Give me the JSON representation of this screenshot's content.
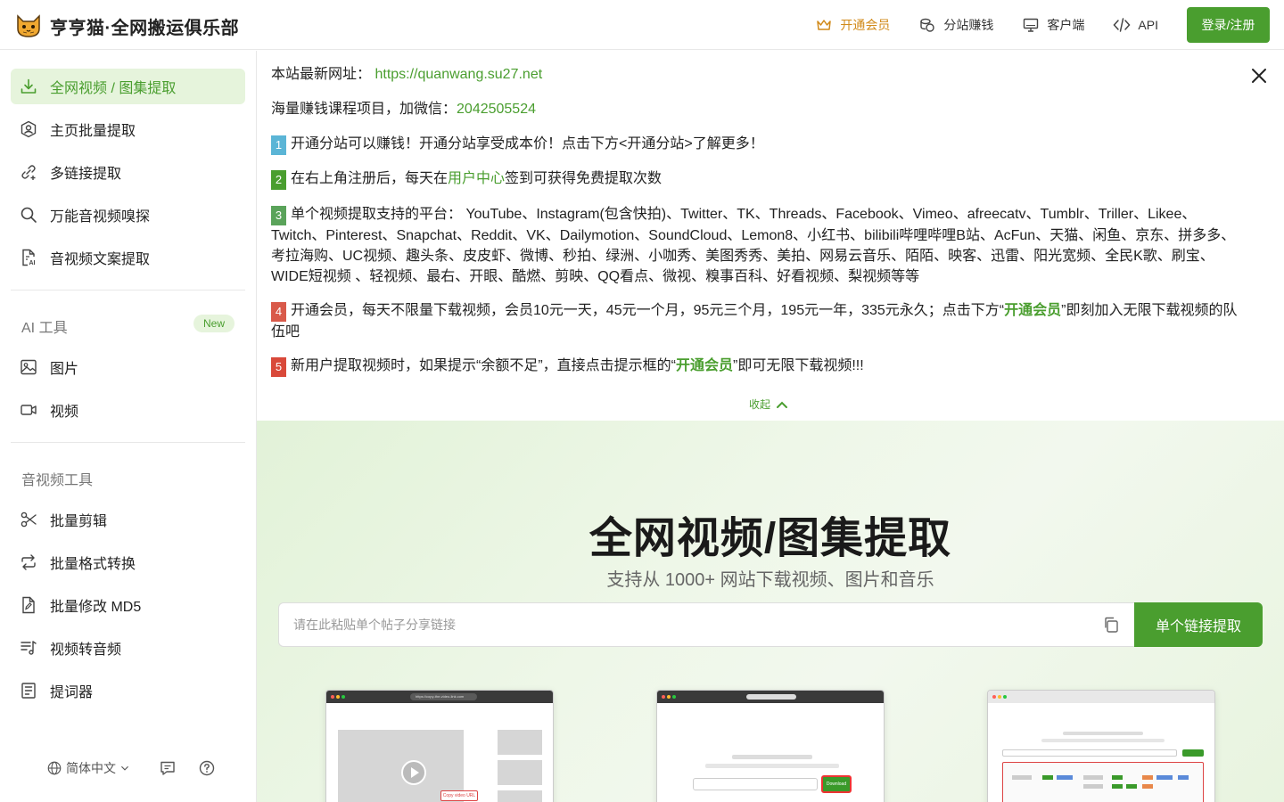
{
  "header": {
    "brand": "亨亨猫·全网搬运俱乐部",
    "nav": {
      "vip": "开通会员",
      "substation": "分站赚钱",
      "client": "客户端",
      "api": "API"
    },
    "login": "登录/注册"
  },
  "sidebar": {
    "items": [
      {
        "label": "全网视频 / 图集提取"
      },
      {
        "label": "主页批量提取"
      },
      {
        "label": "多链接提取"
      },
      {
        "label": "万能音视频嗅探"
      },
      {
        "label": "音视频文案提取"
      }
    ],
    "ai_section": {
      "title": "AI 工具",
      "badge": "New"
    },
    "ai_items": [
      {
        "label": "图片"
      },
      {
        "label": "视频"
      }
    ],
    "av_section": {
      "title": "音视频工具"
    },
    "av_items": [
      {
        "label": "批量剪辑"
      },
      {
        "label": "批量格式转换"
      },
      {
        "label": "批量修改 MD5"
      },
      {
        "label": "视频转音频"
      },
      {
        "label": "提词器"
      }
    ],
    "footer": {
      "language": "简体中文"
    }
  },
  "notice": {
    "site_prefix": "本站最新网址：",
    "site_url": "https://quanwang.su27.net",
    "wechat_prefix": "海量赚钱课程项目，加微信：",
    "wechat_id": "2042505524",
    "items": [
      {
        "num": "1",
        "text": "开通分站可以赚钱！开通分站享受成本价！点击下方<开通分站>了解更多！"
      },
      {
        "num": "2",
        "before": "在右上角注册后，每天在",
        "link": "用户中心",
        "after": "签到可获得免费提取次数"
      },
      {
        "num": "3",
        "text": "单个视频提取支持的平台： YouTube、Instagram(包含快拍)、Twitter、TK、Threads、Facebook、Vimeo、afreecatv、Tumblr、Triller、Likee、Twitch、Pinterest、Snapchat、Reddit、VK、Dailymotion、SoundCloud、Lemon8、小红书、bilibili哔哩哔哩B站、AcFun、天猫、闲鱼、京东、拼多多、考拉海购、UC视频、趣头条、皮皮虾、微博、秒拍、绿洲、小咖秀、美图秀秀、美拍、网易云音乐、陌陌、映客、迅雷、阳光宽频、全民K歌、刷宝、WIDE短视频 、轻视频、最右、开眼、酷燃、剪映、QQ看点、微视、糗事百科、好看视频、梨视频等等"
      },
      {
        "num": "4",
        "before": "开通会员，每天不限量下载视频，会员10元一天，45元一个月，95元三个月，195元一年，335元永久；点击下方“",
        "link": "开通会员",
        "after": "”即刻加入无限下载视频的队伍吧"
      },
      {
        "num": "5",
        "before": "新用户提取视频时，如果提示“余额不足”，直接点击提示框的“",
        "link": "开通会员",
        "after": "”即可无限下载视频!!!"
      }
    ],
    "collapse": "收起"
  },
  "hero": {
    "title": "全网视频/图集提取",
    "subtitle": "支持从 1000+ 网站下载视频、图片和音乐",
    "placeholder": "请在此粘贴单个帖子分享链接",
    "button": "单个链接提取"
  },
  "shots": {
    "shot1_url": "https://copy-the-video-link.com",
    "shot1_tooltip": "Copy video URL",
    "shot2_button": "Download"
  },
  "colors": {
    "accent": "#4a9e2f",
    "accent_light": "#e6f4dc",
    "vip": "#d18a1a"
  }
}
